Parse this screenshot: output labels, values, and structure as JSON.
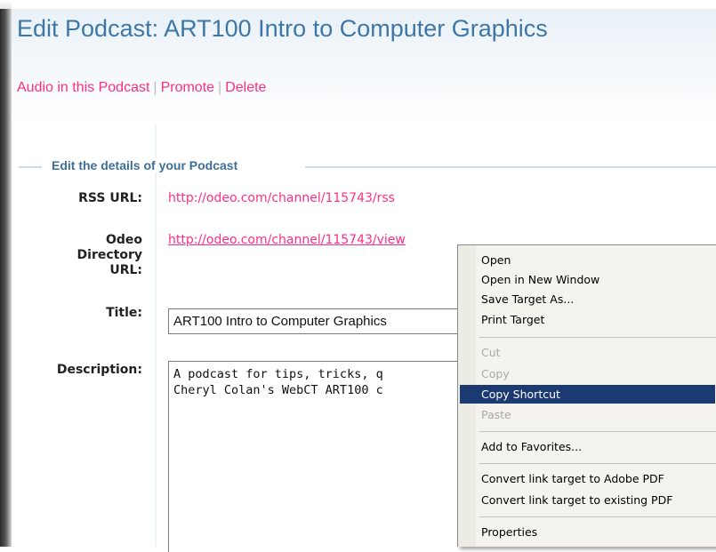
{
  "page": {
    "title": "Edit Podcast: ART100 Intro to Computer Graphics",
    "nav": {
      "audio": "Audio in this Podcast",
      "separator": "|",
      "promote": "Promote",
      "delete": "Delete"
    }
  },
  "form": {
    "legend": "Edit the details of your Podcast",
    "rss_label": "RSS URL:",
    "rss_value": "http://odeo.com/channel/115743/rss",
    "dir_label_1": "Odeo",
    "dir_label_2": "Directory",
    "dir_label_3": "URL:",
    "dir_value": "http://odeo.com/channel/115743/view",
    "title_label": "Title:",
    "title_value": "ART100 Intro to Computer Graphics",
    "desc_label": "Description:",
    "desc_value": "A podcast for tips, tricks, q                           o\nCheryl Colan's WebCT ART100 c"
  },
  "context_menu": {
    "items": [
      {
        "label": "Open",
        "state": "enabled"
      },
      {
        "label": "Open in New Window",
        "state": "enabled"
      },
      {
        "label": "Save Target As...",
        "state": "enabled"
      },
      {
        "label": "Print Target",
        "state": "enabled"
      },
      {
        "label": "Cut",
        "state": "disabled"
      },
      {
        "label": "Copy",
        "state": "disabled"
      },
      {
        "label": "Copy Shortcut",
        "state": "selected"
      },
      {
        "label": "Paste",
        "state": "disabled"
      },
      {
        "label": "Add to Favorites...",
        "state": "enabled"
      },
      {
        "label": "Convert link target to Adobe PDF",
        "state": "enabled"
      },
      {
        "label": "Convert link target to existing PDF",
        "state": "enabled"
      },
      {
        "label": "Properties",
        "state": "enabled"
      }
    ]
  },
  "colors": {
    "title": "#3d77a8",
    "link": "#ff2e84",
    "legend": "#3d6f99",
    "menu_highlight": "#1c3a72"
  }
}
